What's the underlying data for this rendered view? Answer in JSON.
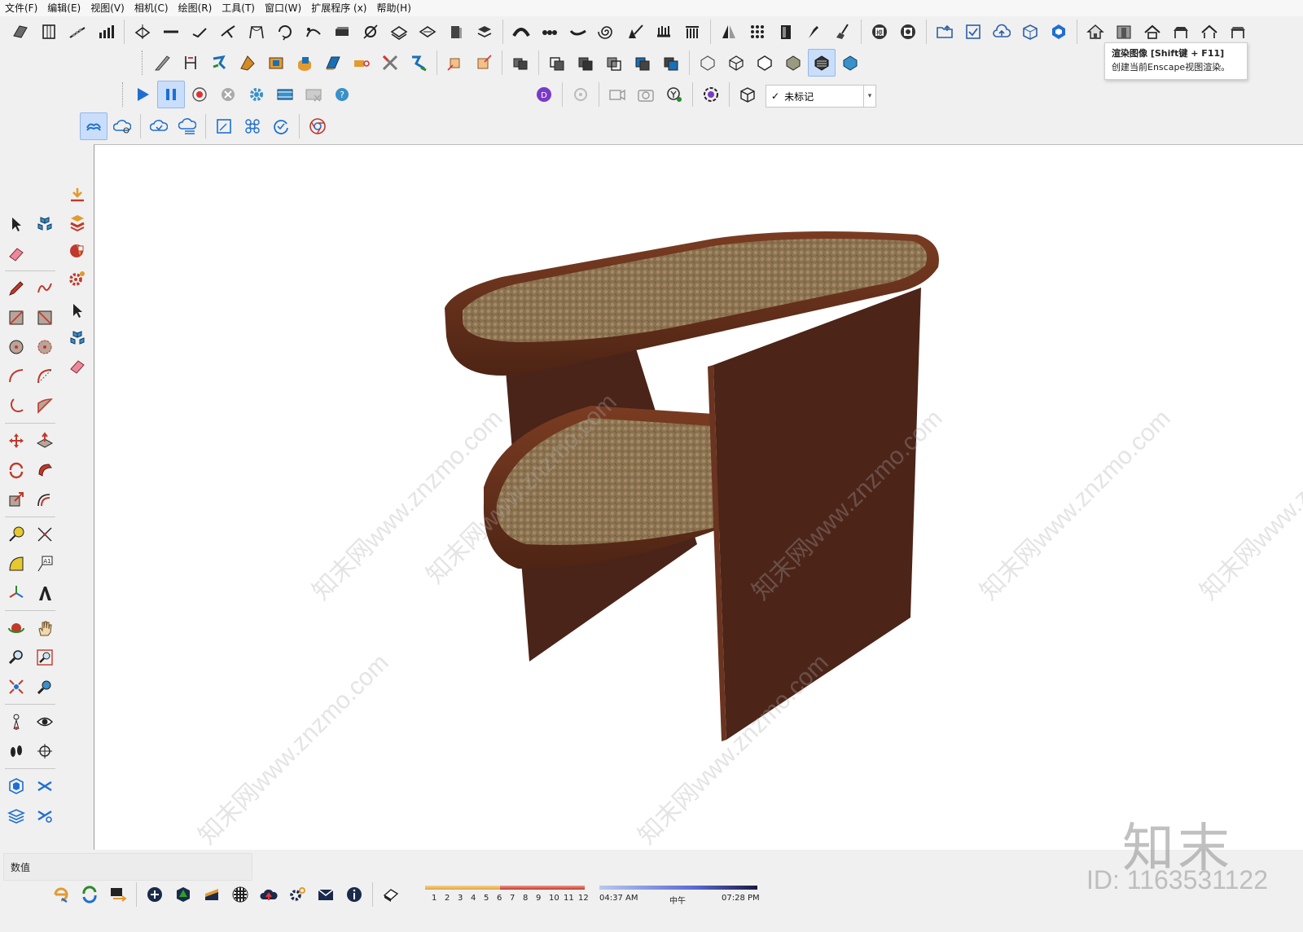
{
  "menu": [
    "文件(F)",
    "编辑(E)",
    "视图(V)",
    "相机(C)",
    "绘图(R)",
    "工具(T)",
    "窗口(W)",
    "扩展程序 (x)",
    "帮助(H)"
  ],
  "tooltip": {
    "title": "渲染图像 [Shift键 + F11]",
    "description": "创建当前Enscape视图渲染。"
  },
  "tag_dropdown": {
    "check": "✓",
    "value": "未标记"
  },
  "measurements": {
    "label": "数值",
    "value": ""
  },
  "shadow": {
    "hours": [
      "1",
      "2",
      "3",
      "4",
      "5",
      "6",
      "7",
      "8",
      "9",
      "10",
      "11",
      "12"
    ],
    "time_start": "04:37 AM",
    "time_mid": "中午",
    "time_end": "07:28 PM"
  },
  "watermark": {
    "logo": "知末",
    "id": "ID: 1163531122",
    "text": "知末网www.znzmo.com"
  },
  "icons": {
    "top_row": [
      "sandbox-icon",
      "column-icon",
      "stairs-icon",
      "bar-chart-icon",
      "soften-icon",
      "align-icon",
      "join-icon",
      "split-icon",
      "arch-icon",
      "loop-icon",
      "curve-icon",
      "extrude-icon",
      "node-icon",
      "layers-icon",
      "shell-icon",
      "column-build-icon",
      "stack-icon",
      "arc-icon",
      "chain-icon",
      "wave-icon",
      "spiral-icon",
      "push-icon",
      "grid-comb-icon",
      "columns-icon",
      "mirror-icon",
      "dots-icon",
      "panel-icon",
      "pen-icon",
      "broom-icon",
      "model-info-icon",
      "clip-icon",
      "folder-icon",
      "checklist-icon",
      "cloud-icon",
      "package-icon",
      "cube-blue-icon",
      "house-icon",
      "wall-icon",
      "roof-icon",
      "roof2-icon",
      "roof3-icon",
      "roof4-icon"
    ],
    "accent": "#1f6fd1"
  },
  "colors": {
    "wood": "#5a2a1a",
    "rattan": "#8a7150",
    "viewport_bg": "#ffffff"
  }
}
